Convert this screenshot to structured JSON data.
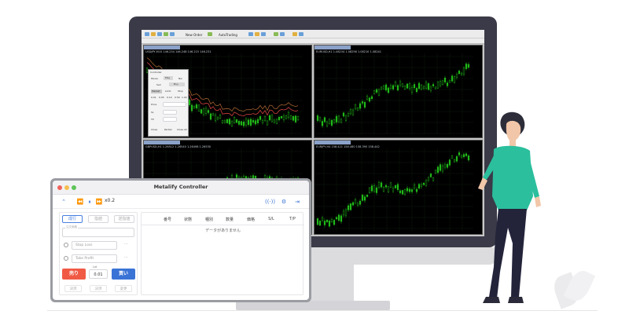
{
  "mt4": {
    "toolbar_items": [
      "New Order",
      "AutoTrading"
    ],
    "charts": [
      {
        "symbol": "USDJPY,M15  146.234 146.248 146.215 146.231"
      },
      {
        "symbol": "EURUSD,H1  1.08234 1.08256 1.08210 1.08241"
      },
      {
        "symbol": "GBPUSD,H1  1.26512 1.26540 1.26498 1.26530"
      },
      {
        "symbol": "EURJPY,H4  158.421 158.460 158.390 158.442"
      }
    ],
    "mini_controller": {
      "title": "Controller",
      "labels": [
        "Pause",
        "Play",
        "Nw",
        "Sell",
        "Buy",
        "Market",
        "Limit",
        "Stop",
        "Price",
        "SL",
        "TP",
        "Close",
        "Partial",
        "Close All"
      ],
      "lots": [
        "0.01",
        "0.05",
        "0.10",
        "0.50",
        "1.00"
      ]
    }
  },
  "app": {
    "title": "Metalify Controller",
    "speed": "x0.2",
    "tabs": [
      "成行",
      "指値",
      "逆指値"
    ],
    "entry_price_label": "注文価格",
    "stop_loss_placeholder": "Stop Loss",
    "take_profit_placeholder": "Take Profit",
    "lot_label": "Lot",
    "lot_value": "0.01",
    "sell_label": "売り",
    "buy_label": "買い",
    "bottom_buttons": [
      "決済",
      "決済",
      "変更"
    ],
    "table_headers": [
      "番号",
      "状態",
      "種別",
      "数量",
      "価格",
      "S/L",
      "T/P"
    ],
    "empty_message": "データがありません"
  },
  "colors": {
    "accent": "#3a73d6",
    "sell": "#f05a45",
    "shirt": "#2bbf9d",
    "chart_bg": "#000000",
    "candle": "#22c01a"
  }
}
